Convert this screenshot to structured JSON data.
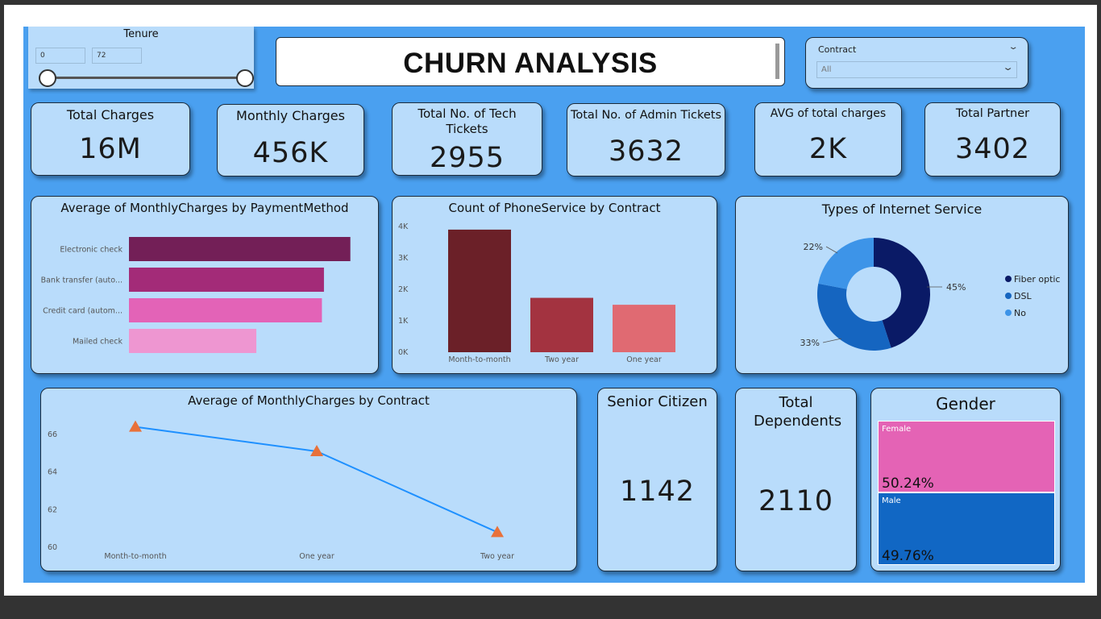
{
  "tenure_slicer": {
    "title": "Tenure",
    "min_value": "0",
    "max_value": "72"
  },
  "header": {
    "title": "CHURN ANALYSIS"
  },
  "contract_slicer": {
    "label": "Contract",
    "selected": "All"
  },
  "kpis": [
    {
      "label": "Total Charges",
      "value": "16M"
    },
    {
      "label": "Monthly Charges",
      "value": "456K"
    },
    {
      "label": "Total No. of Tech Tickets",
      "value": "2955"
    },
    {
      "label": "Total No. of Admin Tickets",
      "value": "3632"
    },
    {
      "label": "AVG of total charges",
      "value": "2K"
    },
    {
      "label": "Total Partner",
      "value": "3402"
    }
  ],
  "payment_chart": {
    "title": "Average of MonthlyCharges by PaymentMethod",
    "chart_data": {
      "type": "bar",
      "orientation": "horizontal",
      "categories": [
        "Electronic check",
        "Bank transfer (auto...",
        "Credit card (autom...",
        "Mailed check"
      ],
      "values": [
        76.3,
        67.2,
        66.5,
        43.9
      ],
      "xlim": [
        0,
        80
      ],
      "colors": [
        "#731f57",
        "#a32b78",
        "#e363b7",
        "#ee96d1"
      ],
      "grid": false,
      "legend": "none"
    }
  },
  "phone_chart": {
    "title": "Count of PhoneService by Contract",
    "chart_data": {
      "type": "bar",
      "categories": [
        "Month-to-month",
        "Two year",
        "One year"
      ],
      "values": [
        3900,
        1730,
        1510
      ],
      "yticks": [
        "0K",
        "1K",
        "2K",
        "3K",
        "4K"
      ],
      "ylim": [
        0,
        4000
      ],
      "colors": [
        "#6b2028",
        "#a33340",
        "#e06a72"
      ],
      "grid": false,
      "legend": "none"
    }
  },
  "internet_chart": {
    "title": "Types of Internet Service",
    "chart_data": {
      "type": "pie",
      "donut": true,
      "labels": [
        "Fiber optic",
        "DSL",
        "No"
      ],
      "values": [
        45,
        33,
        22
      ],
      "value_labels": [
        "45%",
        "33%",
        "22%"
      ],
      "colors": [
        "#0a1a66",
        "#1565c0",
        "#3d94e8"
      ],
      "legend": "right"
    }
  },
  "contract_line_chart": {
    "title": "Average of MonthlyCharges by Contract",
    "chart_data": {
      "type": "line",
      "categories": [
        "Month-to-month",
        "One year",
        "Two year"
      ],
      "values": [
        66.4,
        65.1,
        60.8
      ],
      "yticks": [
        "60",
        "62",
        "64",
        "66"
      ],
      "ylim": [
        60,
        67
      ],
      "line_color": "#1e90ff",
      "marker_color": "#e8713a",
      "marker": "triangle",
      "grid": false,
      "legend": "none"
    }
  },
  "senior": {
    "label": "Senior Citizen",
    "value": "1142"
  },
  "dependents": {
    "label": "Total Dependents",
    "value": "2110"
  },
  "gender": {
    "title": "Gender",
    "items": [
      {
        "name": "Female",
        "pct": "50.24%",
        "value": 50.24,
        "color": "#e463b5"
      },
      {
        "name": "Male",
        "pct": "49.76%",
        "value": 49.76,
        "color": "#1167c4"
      }
    ]
  }
}
